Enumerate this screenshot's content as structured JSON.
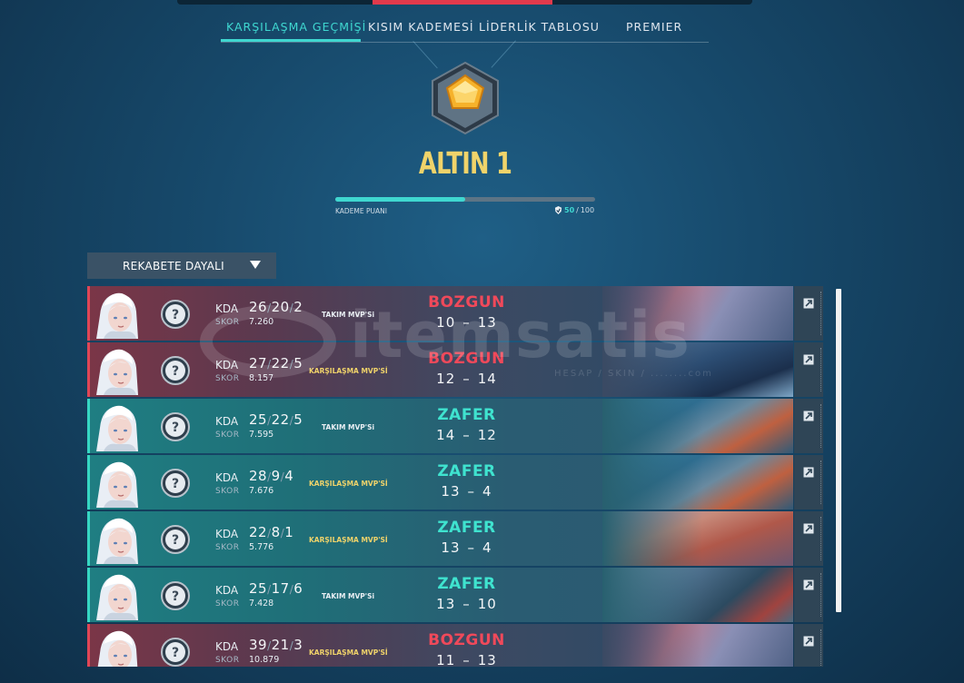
{
  "nav": {
    "tabs": [
      {
        "label": "KARŞILAŞMA GEÇMİŞİ",
        "active": true
      },
      {
        "label": "KISIM KADEMESİ",
        "active": false
      },
      {
        "label": "LİDERLİK TABLOSU",
        "active": false
      },
      {
        "label": "PREMIER",
        "active": false
      }
    ]
  },
  "rank": {
    "name": "ALTIN 1",
    "icon": "gold-rank-emblem-icon",
    "rr_label": "KADEME PUANI",
    "rr_current": "50",
    "rr_separator": "/",
    "rr_max": "100",
    "rr_fraction": 0.5
  },
  "filter": {
    "label": "REKABETE DAYALI"
  },
  "labels": {
    "kda": "KDA",
    "skor": "SKOR"
  },
  "matches": [
    {
      "outcome": "defeat",
      "result": "BOZGUN",
      "k": "26",
      "d": "20",
      "a": "2",
      "score": "7.260",
      "mvp": "TAKIM MVP'Si",
      "mvp_type": "team",
      "rounds_a": "10",
      "rounds_b": "13",
      "map_theme": "pink-city"
    },
    {
      "outcome": "defeat",
      "result": "BOZGUN",
      "k": "27",
      "d": "22",
      "a": "5",
      "score": "8.157",
      "mvp": "KARŞILAŞMA MVP'Sİ",
      "mvp_type": "match",
      "rounds_a": "12",
      "rounds_b": "14",
      "map_theme": "blue-tech"
    },
    {
      "outcome": "victory",
      "result": "ZAFER",
      "k": "25",
      "d": "22",
      "a": "5",
      "score": "7.595",
      "mvp": "TAKIM MVP'Si",
      "mvp_type": "team",
      "rounds_a": "14",
      "rounds_b": "12",
      "map_theme": "ocean"
    },
    {
      "outcome": "victory",
      "result": "ZAFER",
      "k": "28",
      "d": "9",
      "a": "4",
      "score": "7.676",
      "mvp": "KARŞILAŞMA MVP'Sİ",
      "mvp_type": "match",
      "rounds_a": "13",
      "rounds_b": "4",
      "map_theme": "ocean"
    },
    {
      "outcome": "victory",
      "result": "ZAFER",
      "k": "22",
      "d": "8",
      "a": "1",
      "score": "5.776",
      "mvp": "KARŞILAŞMA MVP'Sİ",
      "mvp_type": "match",
      "rounds_a": "13",
      "rounds_b": "4",
      "map_theme": "sunset-town"
    },
    {
      "outcome": "victory",
      "result": "ZAFER",
      "k": "25",
      "d": "17",
      "a": "6",
      "score": "7.428",
      "mvp": "TAKIM MVP'Si",
      "mvp_type": "team",
      "rounds_a": "13",
      "rounds_b": "10",
      "map_theme": "rooftops"
    },
    {
      "outcome": "defeat",
      "result": "BOZGUN",
      "k": "39",
      "d": "21",
      "a": "3",
      "score": "10.879",
      "mvp": "KARŞILAŞMA MVP'Sİ",
      "mvp_type": "match",
      "rounds_a": "11",
      "rounds_b": "13",
      "map_theme": "pink-city"
    }
  ],
  "watermark": {
    "text": "itemsatis",
    "sub": "HESAP / SKIN / ........com"
  },
  "colors": {
    "accent": "#3fd7d0",
    "defeat": "#f0495a",
    "victory": "#3fe3cf",
    "gold": "#f0d36a"
  }
}
